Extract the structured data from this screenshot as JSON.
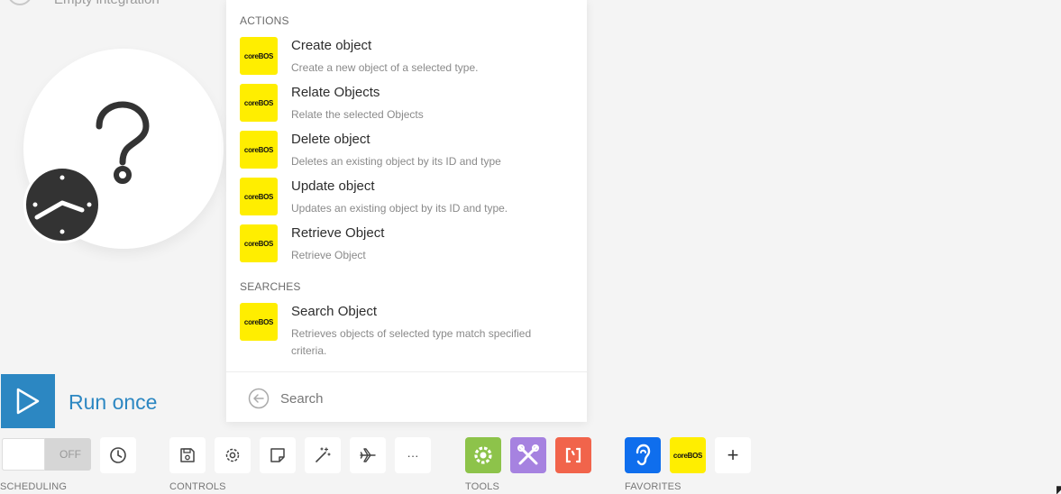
{
  "scenario": {
    "title": "Empty integration"
  },
  "menu": {
    "sections": [
      {
        "title": "ACTIONS",
        "items": [
          {
            "title": "Create object",
            "desc": "Create a new object of a selected type."
          },
          {
            "title": "Relate Objects",
            "desc": "Relate the selected Objects"
          },
          {
            "title": "Delete object",
            "desc": "Deletes an existing object by its ID and type"
          },
          {
            "title": "Update object",
            "desc": "Updates an existing object by its ID and type."
          },
          {
            "title": "Retrieve Object",
            "desc": "Retrieve Object"
          }
        ]
      },
      {
        "title": "SEARCHES",
        "items": [
          {
            "title": "Search Object",
            "desc": "Retrieves objects of selected type match specified criteria."
          }
        ]
      }
    ],
    "logo_text": "coreBOS",
    "search_placeholder": "Search"
  },
  "run": {
    "label": "Run once"
  },
  "scheduling": {
    "toggle_text": "OFF",
    "label": "SCHEDULING"
  },
  "controls": {
    "label": "CONTROLS",
    "more_label": "···"
  },
  "tools": {
    "label": "TOOLS"
  },
  "favorites": {
    "label": "FAVORITES",
    "logo_text": "coreBOS",
    "add_label": "+"
  },
  "icons": {
    "back": "arrow-left-circle-icon",
    "question": "question-mark-icon",
    "clock": "clock-icon",
    "play": "play-icon",
    "schedule": "clock-icon",
    "save": "save-icon",
    "settings": "gear-icon",
    "notes": "note-icon",
    "auto_align": "magic-wand-icon",
    "explain_flow": "airplane-icon",
    "flow_control": "gear-icon",
    "tools": "tools-icon",
    "text_parser": "bracket-icon",
    "webhooks": "ear-icon"
  },
  "colors": {
    "accent": "#2c87c2",
    "corebos_yellow": "#ffee00",
    "flow_control": "#8dc34a",
    "tools": "#a682e0",
    "text_parser": "#f1644b",
    "webhooks": "#0f6eed"
  }
}
